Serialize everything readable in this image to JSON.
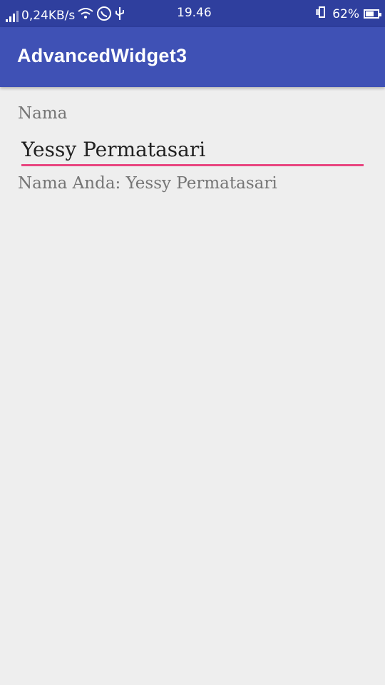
{
  "status_bar": {
    "net_speed": "0,24KB/s",
    "time": "19.46",
    "battery_percent": "62%",
    "icons": [
      "signal-icon",
      "wifi-icon",
      "whatsapp-icon",
      "usb-icon",
      "vibrate-icon",
      "battery-icon"
    ]
  },
  "app_bar": {
    "title": "AdvancedWidget3"
  },
  "form": {
    "label": "Nama",
    "input_value": "Yessy Permatasari",
    "result_text": "Nama Anda: Yessy Permatasari"
  },
  "colors": {
    "status_bar": "#2f3f9e",
    "app_bar": "#3f51b5",
    "accent": "#e8457f",
    "background": "#eeeeee"
  }
}
